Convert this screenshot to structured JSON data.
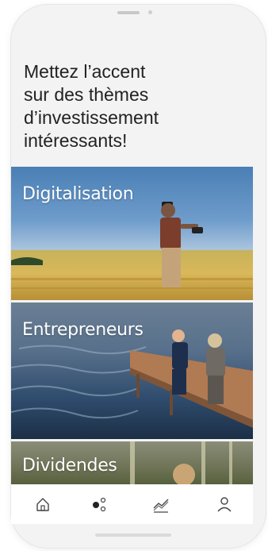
{
  "headline": {
    "line1": "Mettez l’accent",
    "line2": "sur des thèmes",
    "line3": "d’investissement",
    "line4": "intéressants!"
  },
  "themes": [
    {
      "label": "Digitalisation"
    },
    {
      "label": "Entrepreneurs"
    },
    {
      "label": "Dividendes"
    }
  ],
  "nav": [
    {
      "icon": "home-icon"
    },
    {
      "icon": "themes-icon"
    },
    {
      "icon": "chart-icon"
    },
    {
      "icon": "profile-icon"
    }
  ]
}
